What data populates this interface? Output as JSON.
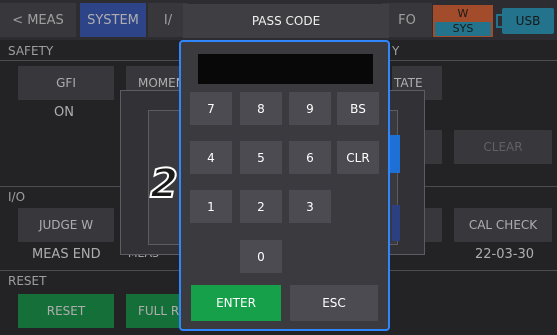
{
  "tabs": {
    "meas": "< MEAS",
    "system": "SYSTEM",
    "io": "I/",
    "info": "FO"
  },
  "indicator": {
    "top": "W",
    "bottom": "SYS"
  },
  "usb": "USB",
  "safety": {
    "label": "SAFETY",
    "gfi_button": "GFI",
    "gfi_value": "ON",
    "momentary_button": "MOMEN",
    "state_button": "TATE",
    "clear_button": "CLEAR",
    "right_letter": "Y"
  },
  "io": {
    "label": "I/O",
    "judge_button": "JUDGE W",
    "judge_value": "MEAS END",
    "partial_value": "MEAS",
    "t_button": "T",
    "cal_check_button": "CAL CHECK",
    "cal_check_value": "22-03-30"
  },
  "reset": {
    "label": "RESET",
    "reset_button": "RESET",
    "full_reset_button": "FULL R"
  },
  "passcode": {
    "title": "PASS CODE",
    "keys_row1": [
      "7",
      "8",
      "9",
      "BS"
    ],
    "keys_row2": [
      "4",
      "5",
      "6",
      "CLR"
    ],
    "keys_row3": [
      "1",
      "2",
      "3"
    ],
    "keys_row4": [
      "0"
    ],
    "enter": "ENTER",
    "esc": "ESC"
  },
  "step_marker": "2",
  "colors": {
    "accent_blue": "#3c5ec6",
    "frame_blue": "#2f86ff",
    "green": "#16a04a",
    "orange": "#ee6a36",
    "usb_cyan": "#2aa7c9"
  }
}
